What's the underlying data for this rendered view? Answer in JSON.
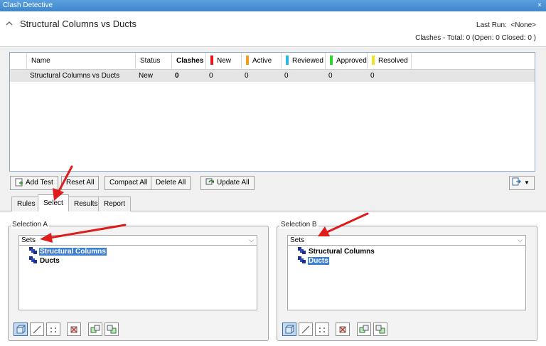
{
  "window": {
    "title": "Clash Detective",
    "close_glyph": "×"
  },
  "header": {
    "test_name": "Structural Columns vs Ducts",
    "last_run_label": "Last Run:",
    "last_run_value": "<None>",
    "summary": "Clashes -  Total:  0  (Open:  0  Closed:  0 )"
  },
  "grid": {
    "columns": [
      "Name",
      "Status",
      "Clashes",
      "New",
      "Active",
      "Reviewed",
      "Approved",
      "Resolved"
    ],
    "status_colors": {
      "New": "#e8141c",
      "Active": "#f29c1f",
      "Reviewed": "#2bb6e8",
      "Approved": "#2ed62e",
      "Resolved": "#f1e61d"
    },
    "rows": [
      [
        "Structural Columns vs Ducts",
        "New",
        "0",
        "0",
        "0",
        "0",
        "0",
        "0"
      ]
    ]
  },
  "toolbar": {
    "add_test": "Add Test",
    "reset_all": "Reset All",
    "compact_all": "Compact All",
    "delete_all": "Delete All",
    "update_all": "Update All"
  },
  "tabs": [
    "Rules",
    "Select",
    "Results",
    "Report"
  ],
  "active_tab": "Select",
  "selection_a": {
    "label": "Selection A",
    "dropdown": "Sets",
    "items": [
      "Structural Columns",
      "Ducts"
    ],
    "selected": "Structural Columns"
  },
  "selection_b": {
    "label": "Selection B",
    "dropdown": "Sets",
    "items": [
      "Structural Columns",
      "Ducts"
    ],
    "selected": "Ducts"
  },
  "accent_color": "#3d7fd3",
  "annotation_arrow_color": "#e01b1b"
}
